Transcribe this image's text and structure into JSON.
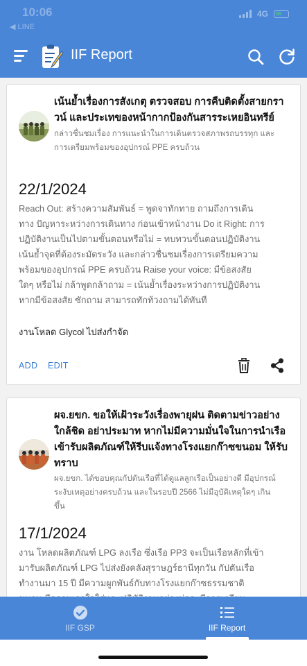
{
  "status_bar": {
    "time": "10:06",
    "back_label": "◀ LINE",
    "network": "4G"
  },
  "app_bar": {
    "title": "IIF Report"
  },
  "reports": [
    {
      "title_line1": "เน้นย้ำเรื่องการสังเกตุ ตรวจสอบ การคืบติดตั้งสายกรา",
      "title_line2": "วน์ และประเทของหน้ากากป้องกันสารระเหยอินทรีย์",
      "subtitle_line1": "กล่าวชื่นชมเรื่อง การแนะนำในการเดินตรวจสภาพรถบรรทุก และ",
      "subtitle_line2": "การเตรียมพร้อมของอุปกรณ์ PPE ครบถ้วน",
      "date": "22/1/2024",
      "body": [
        "Reach Out: สร้างความสัมพันธ์ = พูดจาทักทาย ถามถึงการเดิน",
        "ทาง ปัญหาระหว่างการเดินทาง ก่อนเข้าหน้างาน Do it Right: การ",
        "ปฏิบัติงานเป็นไปตามขั้นตอนหรือไม่ = ทบทวนขั้นตอนปฏิบัติงาน",
        "เน้นย้ำจุดที่ต้องระมัดระวัง และกล่าวชื่นชมเรื่องการเตรียมความ",
        "พร้อมของอุปกรณ์ PPE ครบถ้วน Raise your voice: มีข้อสงสัย",
        "ใดๆ หรือไม่ กล้าพูดกล้าถาม = เน้นย้ำเรื่องระหว่างการปฏิบัติงาน",
        "หากมีข้อสงสัย ซักถาม สามารถทักท้วงถามได้ทันที"
      ],
      "note": "งานโหลด Glycol ไปส่งกำจัด",
      "add_label": "ADD",
      "edit_label": "EDIT"
    },
    {
      "title_line1": "ผจ.ยขก. ขอให้เฝ้าระวังเรื่องพายุฝน ติดตามข่าวอย่าง",
      "title_line2": "ใกล้ชิด อย่าประมาท หากไม่มีความมั่นใจในการนำเรือ",
      "title_line3": "เข้ารับผลิตภัณฑ์ให้รีบแจ้งทางโรงแยกก๊าซขนอม ให้รับ",
      "title_line4": "ทราบ",
      "subtitle_line1": "ผจ.ยขก. ได้ขอบคุณกัปตันเรือที่ได้ดูแลลูกเรือเป็นอย่างดี มีอุปกรณ์",
      "subtitle_line2": "ระงับเหตุอย่างครบถ้วน และในรอบปี 2566 ไม่มีอุบัติเหตุใดๆ เกิน",
      "subtitle_line3": "ขึ้น",
      "date": "17/1/2024",
      "body": [
        "งาน โหลดผลิตภัณฑ์ LPG ลงเรือ ซึ่งเรือ PP3 จะเป็นเรือหลักที่เข้า",
        "มารับผลิตภัณฑ์ LPG ไปส่งยังคลังสุราษฎร์ธานีทุกวัน กัปตันเรือ",
        "ทำงานมา 15 ปี มีความผูกพันธ์กับทางโรงแยกก๊าซธรรมชาติ",
        "ขนอม มีความเอาใจใส่และปฏิบัติงานอย่างน่าจะมีการเตรียม"
      ]
    }
  ],
  "bottom_nav": [
    {
      "label": "IIF GSP",
      "active": false
    },
    {
      "label": "IIF Report",
      "active": true
    }
  ],
  "colors": {
    "primary": "#4a86d8",
    "accent_text": "#3b7fd4"
  }
}
